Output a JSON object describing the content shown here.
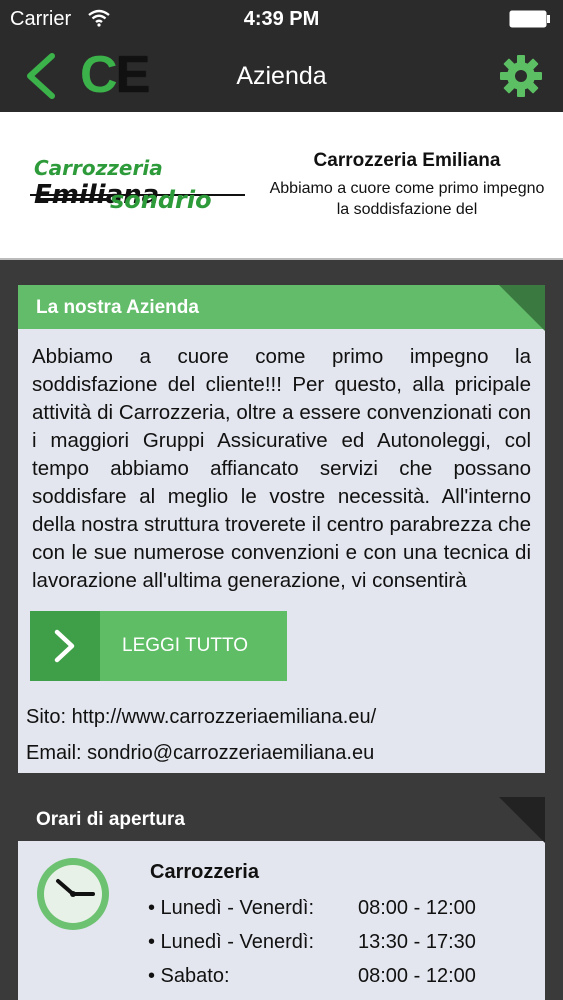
{
  "status_bar": {
    "carrier": "Carrier",
    "time": "4:39 PM"
  },
  "nav": {
    "title": "Azienda",
    "logo_letters": [
      "C",
      "E"
    ],
    "accent_color": "#3cb34a"
  },
  "header": {
    "brand_logo": {
      "line1_prefix": "Carrozzeria",
      "line1_suffix": "Emiliana",
      "line2": "sondrio"
    },
    "title": "Carrozzeria Emiliana",
    "description": "Abbiamo a cuore come primo impegno la soddisfazione del"
  },
  "about": {
    "section_title": "La nostra Azienda",
    "text": "Abbiamo a cuore come primo impegno la soddisfazione del cliente!!! Per questo, alla pricipale attività di Carrozzeria, oltre a essere convenzionati con i maggiori Gruppi Assicurative ed Autonoleggi, col tempo abbiamo affiancato servizi che possano soddisfare al meglio le vostre necessità. All'interno della nostra struttura troverete il centro parabrezza che con le sue numerose convenzioni e con una tecnica di lavorazione all'ultima generazione, vi consentirà",
    "read_more_label": "LEGGI TUTTO",
    "site": "Sito: http://www.carrozzeriaemiliana.eu/",
    "email": "Email: sondrio@carrozzeriaemiliana.eu"
  },
  "hours": {
    "section_title": "Orari di apertura",
    "title": "Carrozzeria",
    "rows": [
      {
        "day": "• Lunedì - Venerdì:",
        "time": "08:00 - 12:00"
      },
      {
        "day": "• Lunedì - Venerdì:",
        "time": "13:30 - 17:30"
      },
      {
        "day": "• Sabato:",
        "time": "08:00 - 12:00"
      }
    ]
  }
}
